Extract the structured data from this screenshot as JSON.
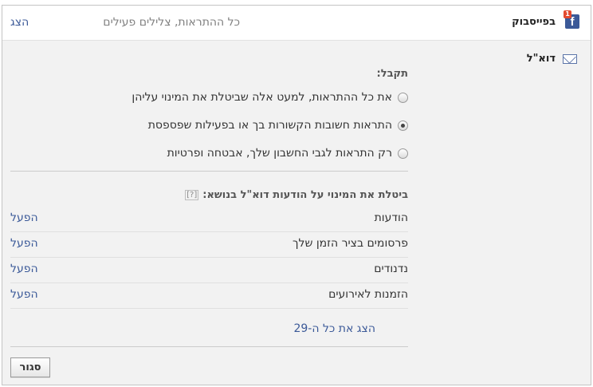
{
  "facebook": {
    "title": "בפייסבוק",
    "badge_count": "1",
    "summary": "כל ההתראות, צלילים פעילים",
    "show_label": "הצג"
  },
  "email": {
    "title": "דוא\"ל",
    "receive_label": "תקבל:",
    "options": [
      {
        "label": "את כל ההתראות, למעט אלה שביטלת את המינוי עליהן",
        "selected": false
      },
      {
        "label": "התראות חשובות הקשורות בך או בפעילות שפספסת",
        "selected": true
      },
      {
        "label": "רק התראות לגבי החשבון שלך, אבטחה ופרטיות",
        "selected": false
      }
    ],
    "unsubscribed_title": "ביטלת את המינוי על הודעות דוא\"ל בנושא:",
    "help_label": "[?]",
    "unsubscribed_items": [
      {
        "name": "הודעות",
        "action": "הפעל"
      },
      {
        "name": "פרסומים בציר הזמן שלך",
        "action": "הפעל"
      },
      {
        "name": "נדנודים",
        "action": "הפעל"
      },
      {
        "name": "הזמנות לאירועים",
        "action": "הפעל"
      }
    ],
    "show_all_label": "הצג את כל ה-29",
    "close_label": "סגור"
  },
  "colors": {
    "link": "#3b5998",
    "panel_background": "#f2f2f2",
    "facebook_blue": "#3b5998"
  }
}
